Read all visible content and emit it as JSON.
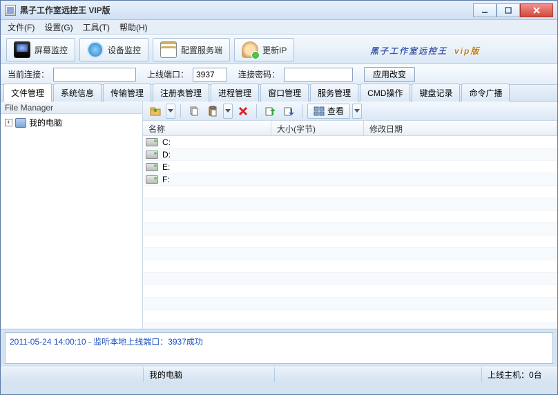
{
  "window": {
    "title": "黑子工作室远控王 VIP版"
  },
  "menu": {
    "file": "文件(F)",
    "settings": "设置(G)",
    "tools": "工具(T)",
    "help": "帮助(H)"
  },
  "toolbar": {
    "screen": "屏幕监控",
    "device": "设备监控",
    "config": "配置服务端",
    "update_ip": "更新IP",
    "brand_main": "黑子工作室远控王",
    "brand_sub": "vip版"
  },
  "form": {
    "current_conn_label": "当前连接：",
    "current_conn_value": "",
    "port_label": "上线端口：",
    "port_value": "3937",
    "pwd_label": "连接密码：",
    "pwd_value": "",
    "apply": "应用改变"
  },
  "tabs": [
    "文件管理",
    "系统信息",
    "传输管理",
    "注册表管理",
    "进程管理",
    "窗口管理",
    "服务管理",
    "CMD操作",
    "键盘记录",
    "命令广播"
  ],
  "sidebar": {
    "title": "File Manager",
    "root": "我的电脑"
  },
  "filetools": {
    "view": "查看"
  },
  "columns": {
    "name": "名称",
    "size": "大小(字节)",
    "date": "修改日期"
  },
  "drives": [
    "C:",
    "D:",
    "E:",
    "F:"
  ],
  "log": "2011-05-24 14:00:10 - 监听本地上线端口：3937成功",
  "status": {
    "path": "我的电脑",
    "online_label": "上线主机：",
    "online_count": "0台"
  }
}
